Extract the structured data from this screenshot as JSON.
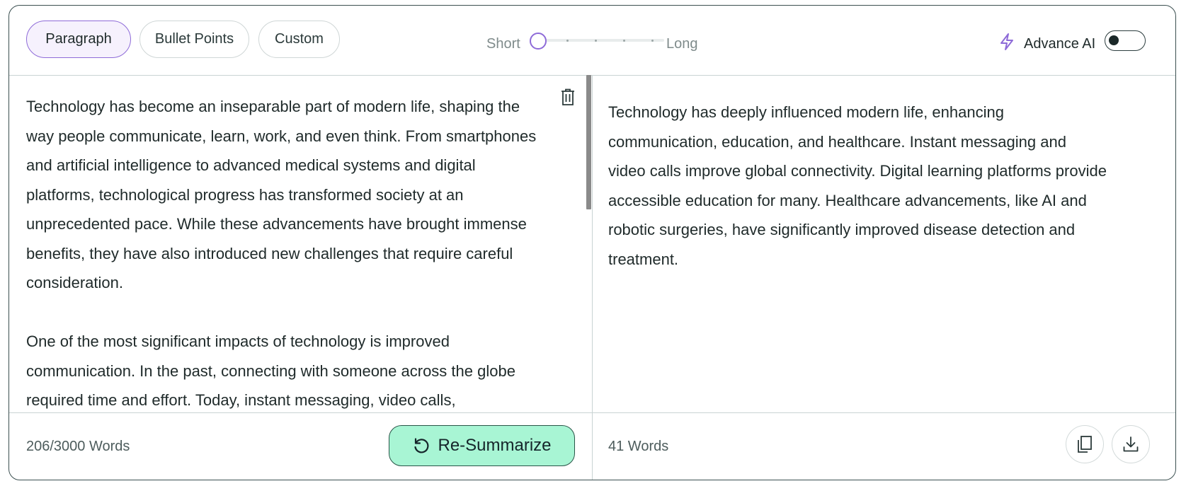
{
  "modes": {
    "paragraph": "Paragraph",
    "bullet_points": "Bullet Points",
    "custom": "Custom",
    "selected": "Paragraph"
  },
  "length": {
    "short_label": "Short",
    "long_label": "Long",
    "steps": 5,
    "value_step": 1
  },
  "advance_ai": {
    "label": "Advance AI",
    "enabled": false
  },
  "input": {
    "paragraphs": [
      "Technology has become an inseparable part of modern life, shaping the way people communicate, learn, work, and even think. From smartphones and artificial intelligence to advanced medical systems and digital platforms, technological progress has transformed society at an unprecedented pace. While these advancements have brought immense benefits, they have also introduced new challenges that require careful consideration.",
      "One of the most significant impacts of technology is improved communication. In the past, connecting with someone across the globe required time and effort. Today, instant messaging, video calls,"
    ],
    "word_count": "206/3000 Words"
  },
  "output": {
    "text": "Technology has deeply influenced modern life, enhancing communication, education, and healthcare. Instant messaging and video calls improve global connectivity. Digital learning platforms provide accessible education for many. Healthcare advancements, like AI and robotic surgeries, have significantly improved disease detection and treatment.",
    "word_count": "41 Words"
  },
  "actions": {
    "resummarize": "Re-Summarize"
  },
  "icons": {
    "bolt": "lightning-bolt-icon",
    "trash": "trash-icon",
    "resummarize": "refresh-icon",
    "copy": "copy-icon",
    "download": "download-icon"
  },
  "colors": {
    "accent_purple": "#8e6bd8",
    "resummarize_bg": "#a8f5d4",
    "border": "#3b4f50"
  }
}
